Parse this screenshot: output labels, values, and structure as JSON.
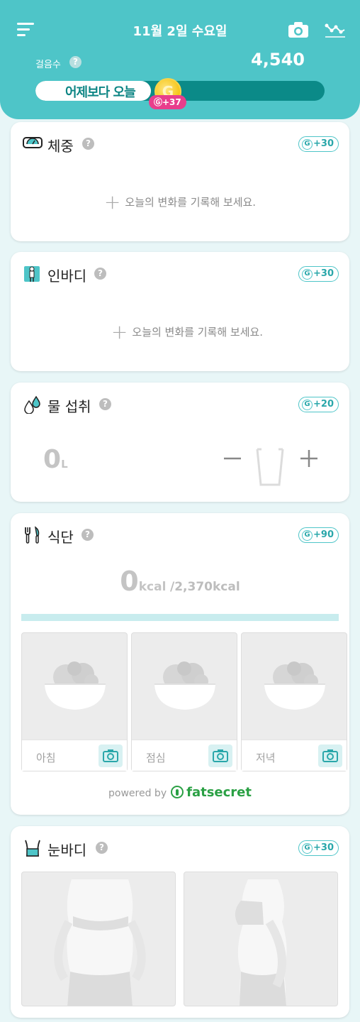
{
  "header": {
    "date": "11월 2일 수요일",
    "steps_label": "걸음수",
    "steps_value": "4,540",
    "progress_text": "어제보다 오늘",
    "progress_fraction": 0.4,
    "coin_label": "G",
    "coin_reward": "Ⓖ+37"
  },
  "help_mark": "?",
  "cards": {
    "weight": {
      "title": "체중",
      "reward": "+30",
      "add_text": "오늘의 변화를 기록해 보세요.",
      "icon": "scale-icon"
    },
    "inbody": {
      "title": "인바디",
      "reward": "+30",
      "add_text": "오늘의 변화를 기록해 보세요.",
      "icon": "inbody-icon"
    },
    "water": {
      "title": "물 섭취",
      "reward": "+20",
      "amount": "0",
      "unit": "L",
      "icon": "water-drop-icon"
    },
    "diet": {
      "title": "식단",
      "reward": "+90",
      "kcal_value": "0",
      "kcal_unit": "kcal",
      "kcal_target": "/2,370kcal",
      "meals": [
        {
          "label": "아침"
        },
        {
          "label": "점심"
        },
        {
          "label": "저녁"
        }
      ],
      "powered_by": "powered by",
      "brand": "fatsecret",
      "icon": "utensils-icon"
    },
    "eyebody": {
      "title": "눈바디",
      "reward": "+30",
      "icon": "waist-icon"
    }
  },
  "colors": {
    "brand": "#4ec5c8",
    "brand_dark": "#0b8a88",
    "badge": "#e83e8c",
    "fatsecret": "#2aa044"
  }
}
